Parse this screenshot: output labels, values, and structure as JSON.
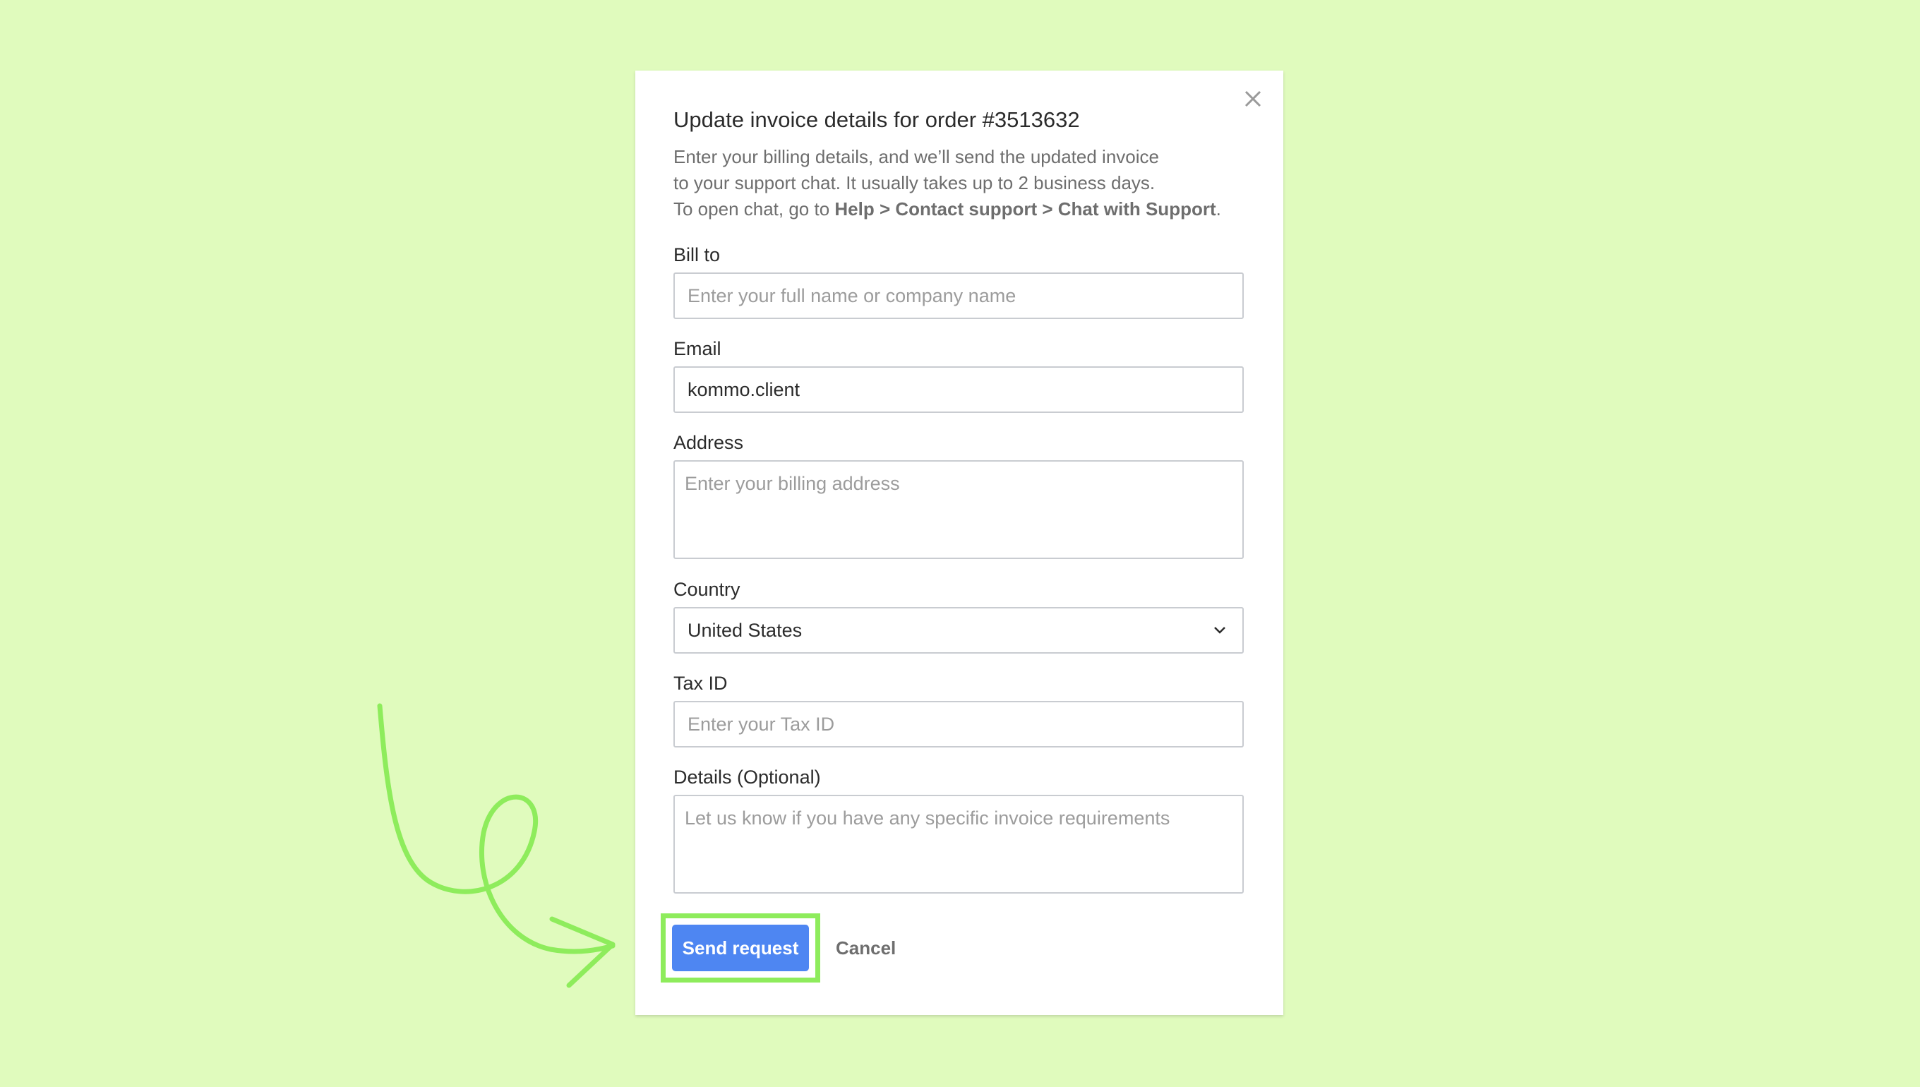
{
  "colors": {
    "background": "#e0fbbd",
    "accent": "#4e86f2",
    "highlight": "#8eec5c"
  },
  "dialog": {
    "title": "Update invoice details for order #3513632",
    "description": {
      "line1": "Enter your billing details, and we’ll send the updated invoice",
      "line2": "to your support chat. It usually takes up to 2 business days.",
      "line3_prefix": "To open chat, go to ",
      "line3_path": "Help > Contact support > Chat with Support",
      "line3_suffix": "."
    },
    "close_icon": "close-icon"
  },
  "form": {
    "bill_to": {
      "label": "Bill to",
      "value": "",
      "placeholder": "Enter your full name or company name"
    },
    "email": {
      "label": "Email",
      "value": "kommo.client",
      "placeholder": ""
    },
    "address": {
      "label": "Address",
      "value": "",
      "placeholder": "Enter your billing address"
    },
    "country": {
      "label": "Country",
      "value": "United States",
      "icon": "chevron-down-icon"
    },
    "tax_id": {
      "label": "Tax ID",
      "value": "",
      "placeholder": "Enter your Tax ID"
    },
    "details": {
      "label": "Details (Optional)",
      "value": "",
      "placeholder": "Let us know if you have any specific invoice requirements"
    }
  },
  "actions": {
    "send_label": "Send request",
    "cancel_label": "Cancel"
  },
  "annotation": {
    "icon": "curly-arrow-icon"
  }
}
